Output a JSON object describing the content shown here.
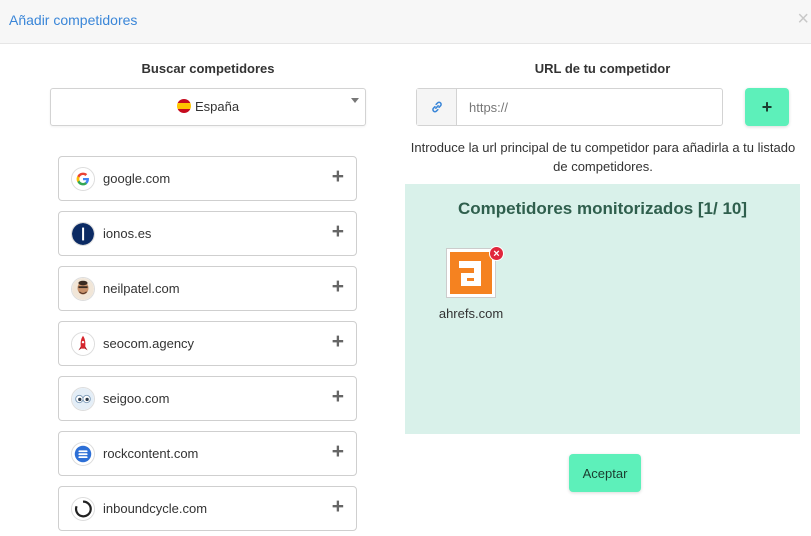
{
  "header": {
    "title": "Añadir competidores",
    "close_label": "×"
  },
  "search": {
    "title": "Buscar competidores",
    "country": "España",
    "competitors": [
      {
        "name": "google.com",
        "logo": "google-logo-icon"
      },
      {
        "name": "ionos.es",
        "logo": "ionos-logo-icon"
      },
      {
        "name": "neilpatel.com",
        "logo": "neilpatel-avatar-icon"
      },
      {
        "name": "seocom.agency",
        "logo": "seocom-rocket-icon"
      },
      {
        "name": "seigoo.com",
        "logo": "seigoo-eyes-icon"
      },
      {
        "name": "rockcontent.com",
        "logo": "rockcontent-logo-icon"
      },
      {
        "name": "inboundcycle.com",
        "logo": "inboundcycle-ring-icon"
      }
    ],
    "add_label": "+"
  },
  "url": {
    "title": "URL de tu competidor",
    "placeholder": "https://",
    "add_label": "+",
    "help": "Introduce la url principal de tu competidor para añadirla a tu listado de competidores."
  },
  "monitored": {
    "title": "Competidores monitorizados [1/ 10]",
    "items": [
      {
        "name": "ahrefs.com",
        "logo": "ahrefs-logo-icon",
        "remove_label": "×"
      }
    ]
  },
  "accept_label": "Aceptar",
  "colors": {
    "accent": "#5df0ba",
    "link": "#3a86d8",
    "panel": "#d9f1ea",
    "remove": "#e0273c"
  }
}
